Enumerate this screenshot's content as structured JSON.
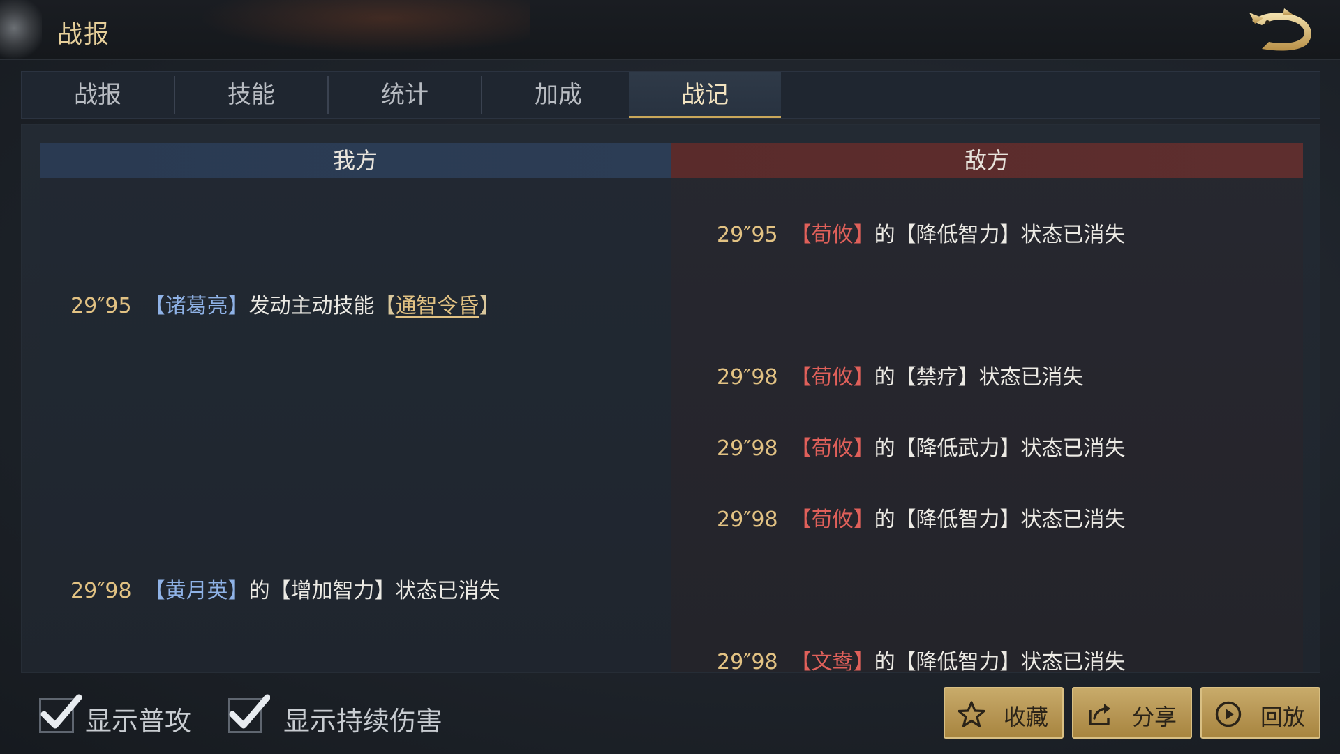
{
  "header": {
    "title": "战报"
  },
  "tabs": [
    {
      "label": "战报"
    },
    {
      "label": "技能"
    },
    {
      "label": "统计"
    },
    {
      "label": "加成"
    },
    {
      "label": "战记"
    }
  ],
  "active_tab": "战记",
  "columns": {
    "ally": "我方",
    "enemy": "敌方"
  },
  "logs": [
    {
      "side": "enemy",
      "time": "29″95",
      "open": "【",
      "name": "荀攸",
      "close": "】",
      "text1": "的【降低智力】状态已消失"
    },
    {
      "side": "ally",
      "time": "29″95",
      "open": "【",
      "name": "诸葛亮",
      "close": "】",
      "text1": "发动主动技能",
      "skill_open": "【",
      "skill": "通智令昏",
      "skill_close": "】"
    },
    {
      "side": "enemy",
      "time": "29″98",
      "open": "【",
      "name": "荀攸",
      "close": "】",
      "text1": "的【禁疗】状态已消失"
    },
    {
      "side": "enemy",
      "time": "29″98",
      "open": "【",
      "name": "荀攸",
      "close": "】",
      "text1": "的【降低武力】状态已消失"
    },
    {
      "side": "enemy",
      "time": "29″98",
      "open": "【",
      "name": "荀攸",
      "close": "】",
      "text1": "的【降低智力】状态已消失"
    },
    {
      "side": "ally",
      "time": "29″98",
      "open": "【",
      "name": "黄月英",
      "close": "】",
      "text1": "的【增加智力】状态已消失"
    },
    {
      "side": "enemy",
      "time": "29″98",
      "open": "【",
      "name": "文鸯",
      "close": "】",
      "text1": "的【降低智力】状态已消失"
    }
  ],
  "footer": {
    "show_normal_attack": {
      "label": "显示普攻",
      "checked": true
    },
    "show_dot": {
      "label": "显示持续伤害",
      "checked": true
    },
    "buttons": [
      {
        "label": "收藏",
        "icon": "star-icon"
      },
      {
        "label": "分享",
        "icon": "share-icon"
      },
      {
        "label": "回放",
        "icon": "play-icon"
      }
    ]
  },
  "colors": {
    "time": "#e2c283",
    "ally_name": "#8fb2e6",
    "enemy_name": "#e0605a",
    "accent_gold": "#c9a75a"
  }
}
